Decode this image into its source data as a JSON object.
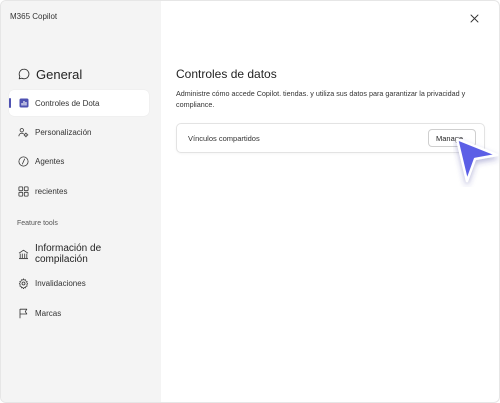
{
  "window": {
    "app_title": "M365 Copilot",
    "close_icon": "close-icon"
  },
  "sidebar": {
    "items": [
      {
        "label": "General",
        "icon": "chat-bubble-icon"
      },
      {
        "label": "Controles de Dota",
        "icon": "data-chart-icon",
        "active": true
      },
      {
        "label": "Personalización",
        "icon": "people-settings-icon"
      },
      {
        "label": "Agentes",
        "icon": "code-icon"
      },
      {
        "label": "recientes",
        "icon": "apps-grid-icon"
      }
    ],
    "section_label": "Feature tools",
    "tool_items": [
      {
        "label": "Información de compilación",
        "icon": "building-icon"
      },
      {
        "label": "Invalidaciones",
        "icon": "gear-icon"
      },
      {
        "label": "Marcas",
        "icon": "flag-icon"
      }
    ]
  },
  "main": {
    "title": "Controles de datos",
    "description": "Administre cómo accede Copilot. tiendas. y utiliza sus datos para garantizar la privacidad y compliance.",
    "card": {
      "label": "Vínculos compartidos",
      "button_label": "Manage"
    }
  },
  "colors": {
    "accent": "#4f52b2",
    "cursor": "#5b5fe6",
    "sidebar_bg": "#f4f4f4"
  }
}
